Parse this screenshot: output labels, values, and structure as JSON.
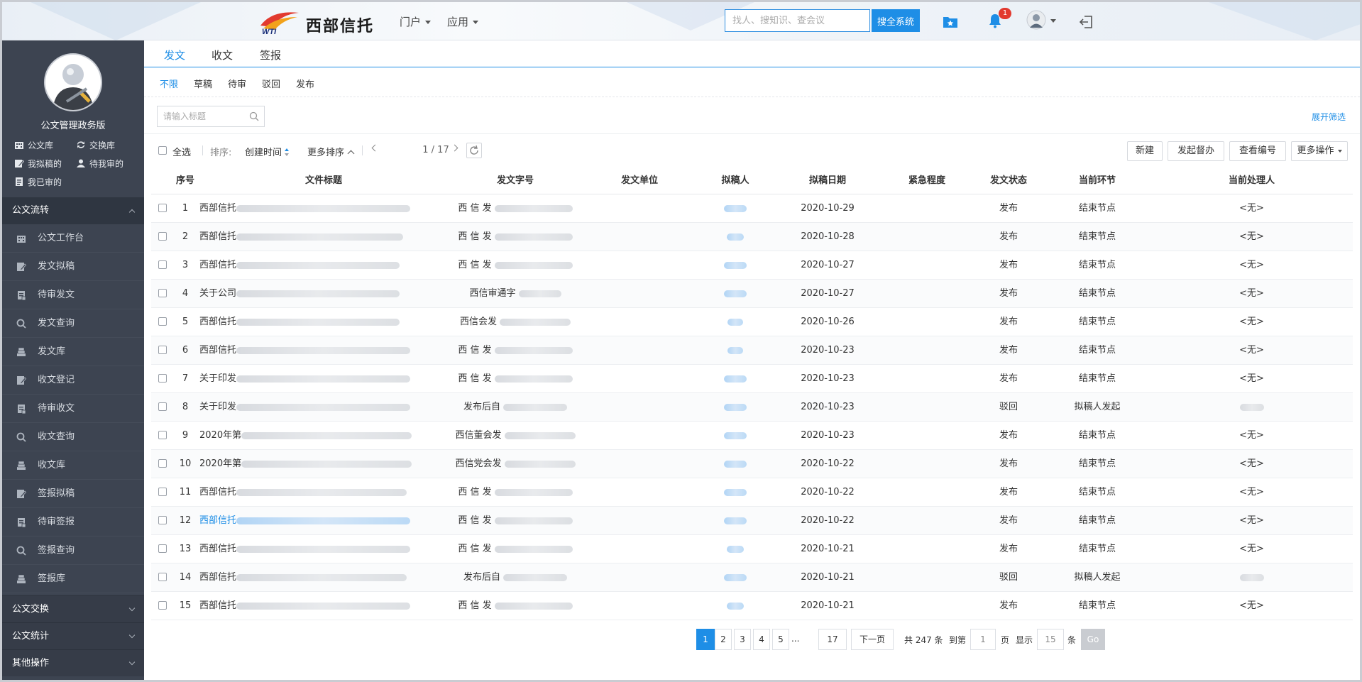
{
  "header": {
    "brand": "西部信托",
    "logo_abbr": "WTI",
    "menus": [
      {
        "label": "门户"
      },
      {
        "label": "应用"
      }
    ],
    "search_placeholder": "找人、搜知识、查会议",
    "search_button": "搜全系统",
    "notification_count": "1",
    "colors": {
      "accent": "#1e8ee6",
      "badge": "#e23a2f"
    }
  },
  "sidebar": {
    "app_title": "公文管理政务版",
    "quick_links": [
      {
        "label": "公文库",
        "icon": "building-icon"
      },
      {
        "label": "交换库",
        "icon": "exchange-icon"
      },
      {
        "label": "我拟稿的",
        "icon": "draft-icon"
      },
      {
        "label": "待我审的",
        "icon": "user-icon"
      },
      {
        "label": "我已审的",
        "icon": "reviewed-icon"
      }
    ],
    "groups": [
      {
        "label": "公文流转",
        "state": "open"
      },
      {
        "label": "公文交换",
        "state": "collapsed"
      },
      {
        "label": "公文统计",
        "state": "collapsed"
      },
      {
        "label": "其他操作",
        "state": "collapsed"
      }
    ],
    "items": [
      {
        "label": "公文工作台",
        "icon": "workbench-icon"
      },
      {
        "label": "发文拟稿",
        "icon": "edit-icon"
      },
      {
        "label": "待审发文",
        "icon": "document-icon"
      },
      {
        "label": "发文查询",
        "icon": "search-icon"
      },
      {
        "label": "发文库",
        "icon": "stack-icon"
      },
      {
        "label": "收文登记",
        "icon": "edit-icon"
      },
      {
        "label": "待审收文",
        "icon": "document-icon"
      },
      {
        "label": "收文查询",
        "icon": "search-icon"
      },
      {
        "label": "收文库",
        "icon": "stack-icon"
      },
      {
        "label": "签报拟稿",
        "icon": "edit-icon"
      },
      {
        "label": "待审签报",
        "icon": "document-icon"
      },
      {
        "label": "签报查询",
        "icon": "search-icon"
      },
      {
        "label": "签报库",
        "icon": "stack-icon"
      }
    ]
  },
  "main": {
    "tabs": [
      "发文",
      "收文",
      "签报"
    ],
    "active_tab": "发文",
    "subtabs": [
      "不限",
      "草稿",
      "待审",
      "驳回",
      "发布"
    ],
    "active_subtab": "不限",
    "filter_placeholder": "请输入标题",
    "expand_filter": "展开筛选",
    "toolbar": {
      "select_all": "全选",
      "sort_label": "排序:",
      "sort_field": "创建时间",
      "more_sort": "更多排序",
      "page_indicator": "1 / 17",
      "buttons": [
        "新建",
        "发起督办",
        "查看编号",
        "更多操作"
      ]
    },
    "columns": [
      "序号",
      "文件标题",
      "发文字号",
      "发文单位",
      "拟稿人",
      "拟稿日期",
      "紧急程度",
      "发文状态",
      "当前环节",
      "当前处理人"
    ],
    "rows": [
      {
        "no": "1",
        "title": "西部信托",
        "code": "西 信 发",
        "unit": "",
        "date": "2020-10-29",
        "urgency": "",
        "status": "发布",
        "step": "结束节点",
        "handler": "<无>"
      },
      {
        "no": "2",
        "title": "西部信托",
        "code": "西 信 发",
        "unit": "",
        "date": "2020-10-28",
        "urgency": "",
        "status": "发布",
        "step": "结束节点",
        "handler": "<无>"
      },
      {
        "no": "3",
        "title": "西部信托",
        "code": "西 信 发",
        "unit": "",
        "date": "2020-10-27",
        "urgency": "",
        "status": "发布",
        "step": "结束节点",
        "handler": "<无>"
      },
      {
        "no": "4",
        "title": "关于公司",
        "code": "西信审通字",
        "unit": "",
        "date": "2020-10-27",
        "urgency": "",
        "status": "发布",
        "step": "结束节点",
        "handler": "<无>"
      },
      {
        "no": "5",
        "title": "西部信托",
        "code": "西信会发",
        "unit": "",
        "date": "2020-10-26",
        "urgency": "",
        "status": "发布",
        "step": "结束节点",
        "handler": "<无>"
      },
      {
        "no": "6",
        "title": "西部信托",
        "code": "西 信 发",
        "unit": "",
        "date": "2020-10-23",
        "urgency": "",
        "status": "发布",
        "step": "结束节点",
        "handler": "<无>"
      },
      {
        "no": "7",
        "title": "关于印发",
        "code": "西 信 发",
        "unit": "",
        "date": "2020-10-23",
        "urgency": "",
        "status": "发布",
        "step": "结束节点",
        "handler": "<无>"
      },
      {
        "no": "8",
        "title": "关于印发",
        "code": "发布后自",
        "unit": "",
        "date": "2020-10-23",
        "urgency": "",
        "status": "驳回",
        "step": "拟稿人发起",
        "handler": ""
      },
      {
        "no": "9",
        "title": "2020年第",
        "code": "西信董会发",
        "unit": "",
        "date": "2020-10-23",
        "urgency": "",
        "status": "发布",
        "step": "结束节点",
        "handler": "<无>"
      },
      {
        "no": "10",
        "title": "2020年第",
        "code": "西信党会发",
        "unit": "",
        "date": "2020-10-22",
        "urgency": "",
        "status": "发布",
        "step": "结束节点",
        "handler": "<无>"
      },
      {
        "no": "11",
        "title": "西部信托",
        "code": "西 信 发",
        "unit": "",
        "date": "2020-10-22",
        "urgency": "",
        "status": "发布",
        "step": "结束节点",
        "handler": "<无>"
      },
      {
        "no": "12",
        "title": "西部信托",
        "code": "西 信 发",
        "unit": "",
        "date": "2020-10-22",
        "urgency": "",
        "status": "发布",
        "step": "结束节点",
        "handler": "<无>"
      },
      {
        "no": "13",
        "title": "西部信托",
        "code": "西 信 发",
        "unit": "",
        "date": "2020-10-21",
        "urgency": "",
        "status": "发布",
        "step": "结束节点",
        "handler": "<无>"
      },
      {
        "no": "14",
        "title": "西部信托",
        "code": "发布后自",
        "unit": "",
        "date": "2020-10-21",
        "urgency": "",
        "status": "驳回",
        "step": "拟稿人发起",
        "handler": ""
      },
      {
        "no": "15",
        "title": "西部信托",
        "code": "西 信 发",
        "unit": "",
        "date": "2020-10-21",
        "urgency": "",
        "status": "发布",
        "step": "结束节点",
        "handler": "<无>"
      }
    ],
    "pagination": {
      "pages": [
        "1",
        "2",
        "3",
        "4",
        "5",
        "...",
        "17"
      ],
      "current": "1",
      "next": "下一页",
      "total": "共 247 条",
      "goto_label": "到第",
      "goto_value": "1",
      "page_unit": "页",
      "show_label": "显示",
      "page_size": "15",
      "item_unit": "条",
      "go": "Go"
    }
  }
}
